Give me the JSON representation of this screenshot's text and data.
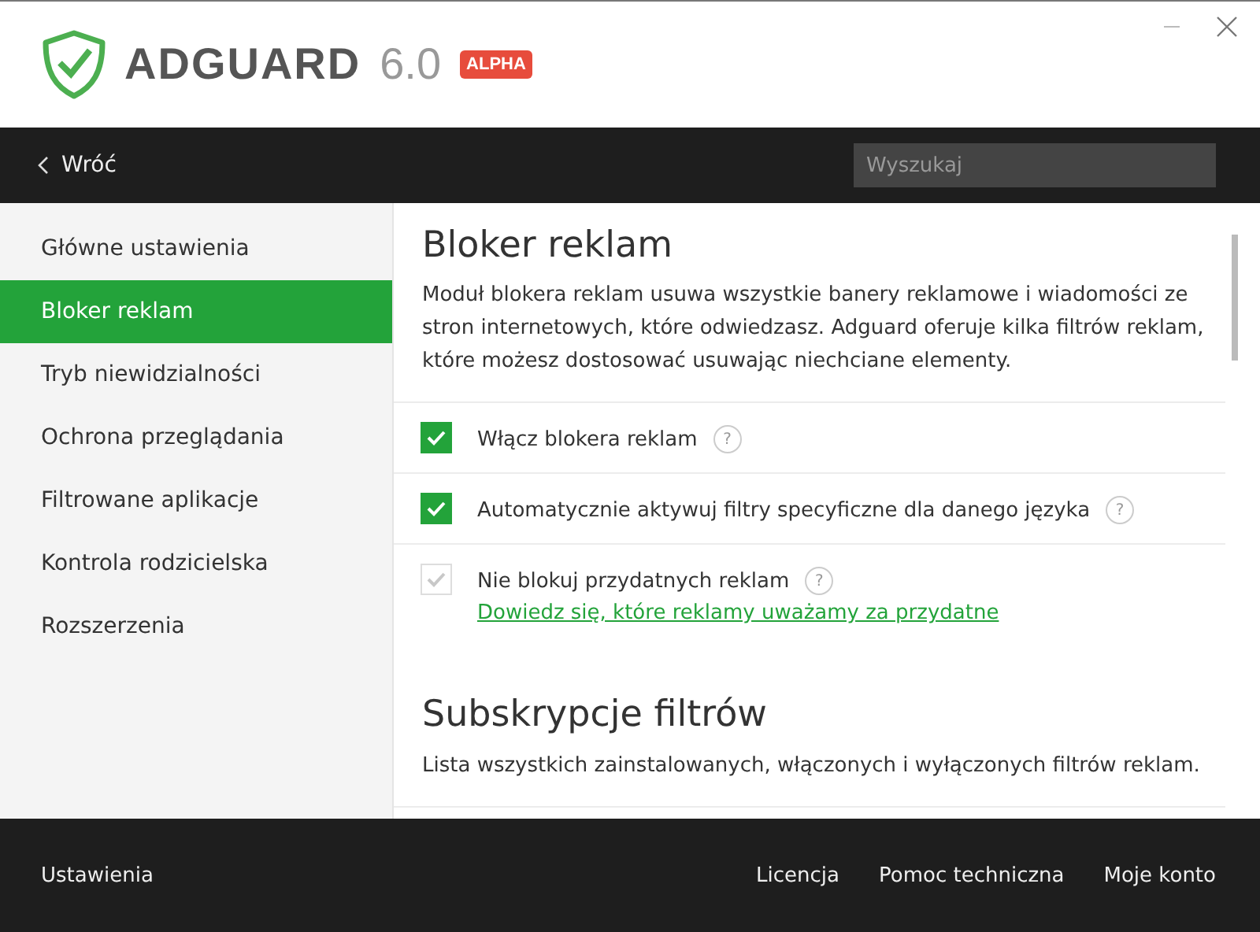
{
  "header": {
    "brand": "ADGUARD",
    "version": "6.0",
    "badge": "ALPHA"
  },
  "nav": {
    "back": "Wróć",
    "search": {
      "placeholder": "Wyszukaj"
    }
  },
  "sidebar": {
    "items": [
      {
        "label": "Główne ustawienia",
        "selected": false
      },
      {
        "label": "Bloker reklam",
        "selected": true
      },
      {
        "label": "Tryb niewidzialności",
        "selected": false
      },
      {
        "label": "Ochrona przeglądania",
        "selected": false
      },
      {
        "label": "Filtrowane aplikacje",
        "selected": false
      },
      {
        "label": "Kontrola rodzicielska",
        "selected": false
      },
      {
        "label": "Rozszerzenia",
        "selected": false
      }
    ]
  },
  "content": {
    "title": "Bloker reklam",
    "description": "Moduł blokera reklam usuwa wszystkie banery reklamowe i wiadomości ze stron internetowych, które odwiedzasz. Adguard oferuje kilka filtrów reklam, które możesz dostosować usuwając niechciane elementy.",
    "options": [
      {
        "label": "Włącz blokera reklam",
        "checked": true,
        "disabled": false,
        "help": "?"
      },
      {
        "label": "Automatycznie aktywuj filtry specyficzne dla danego języka",
        "checked": true,
        "disabled": false,
        "help": "?"
      },
      {
        "label": "Nie blokuj przydatnych reklam",
        "checked": true,
        "disabled": true,
        "help": "?",
        "link": "Dowiedz się, które reklamy uważamy za przydatne"
      }
    ],
    "section": {
      "title": "Subskrypcje filtrów",
      "description": "Lista wszystkich zainstalowanych, włączonych i wyłączonych filtrów reklam."
    }
  },
  "footer": {
    "left": "Ustawienia",
    "links": [
      "Licencja",
      "Pomoc techniczna",
      "Moje konto"
    ]
  }
}
